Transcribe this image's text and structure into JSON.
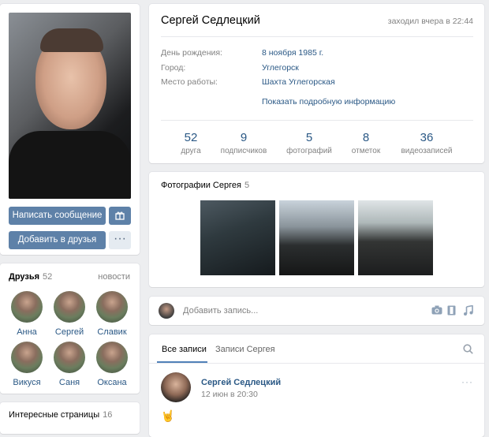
{
  "profile": {
    "name": "Сергей Седлецкий",
    "last_seen": "заходил вчера в 22:44",
    "fields": [
      {
        "label": "День рождения:",
        "value": "8 ноября 1985 г."
      },
      {
        "label": "Город:",
        "value": "Углегорск"
      },
      {
        "label": "Место работы:",
        "value": "Шахта Углегорская"
      }
    ],
    "show_more": "Показать подробную информацию",
    "counters": [
      {
        "value": "52",
        "label": "друга"
      },
      {
        "value": "9",
        "label": "подписчиков"
      },
      {
        "value": "5",
        "label": "фотографий"
      },
      {
        "value": "8",
        "label": "отметок"
      },
      {
        "value": "36",
        "label": "видеозаписей"
      }
    ]
  },
  "actions": {
    "message": "Написать сообщение",
    "add_friend": "Добавить в друзья",
    "more": "···"
  },
  "friends": {
    "title": "Друзья",
    "count": "52",
    "link": "новости",
    "items": [
      {
        "name": "Анна"
      },
      {
        "name": "Сергей"
      },
      {
        "name": "Славик"
      },
      {
        "name": "Викуся"
      },
      {
        "name": "Саня"
      },
      {
        "name": "Оксана"
      }
    ]
  },
  "interests": {
    "title": "Интересные страницы",
    "count": "16"
  },
  "photos": {
    "title": "Фотографии Сергея",
    "count": "5"
  },
  "post_box": {
    "placeholder": "Добавить запись..."
  },
  "wall": {
    "tabs": [
      "Все записи",
      "Записи Сергея"
    ],
    "post": {
      "author": "Сергей Седлецкий",
      "date": "12 июн в 20:30",
      "content": "🤘"
    }
  },
  "colors": {
    "link": "#2a5885",
    "button": "#5e81a8",
    "muted": "#828282",
    "background": "#edeef0"
  }
}
